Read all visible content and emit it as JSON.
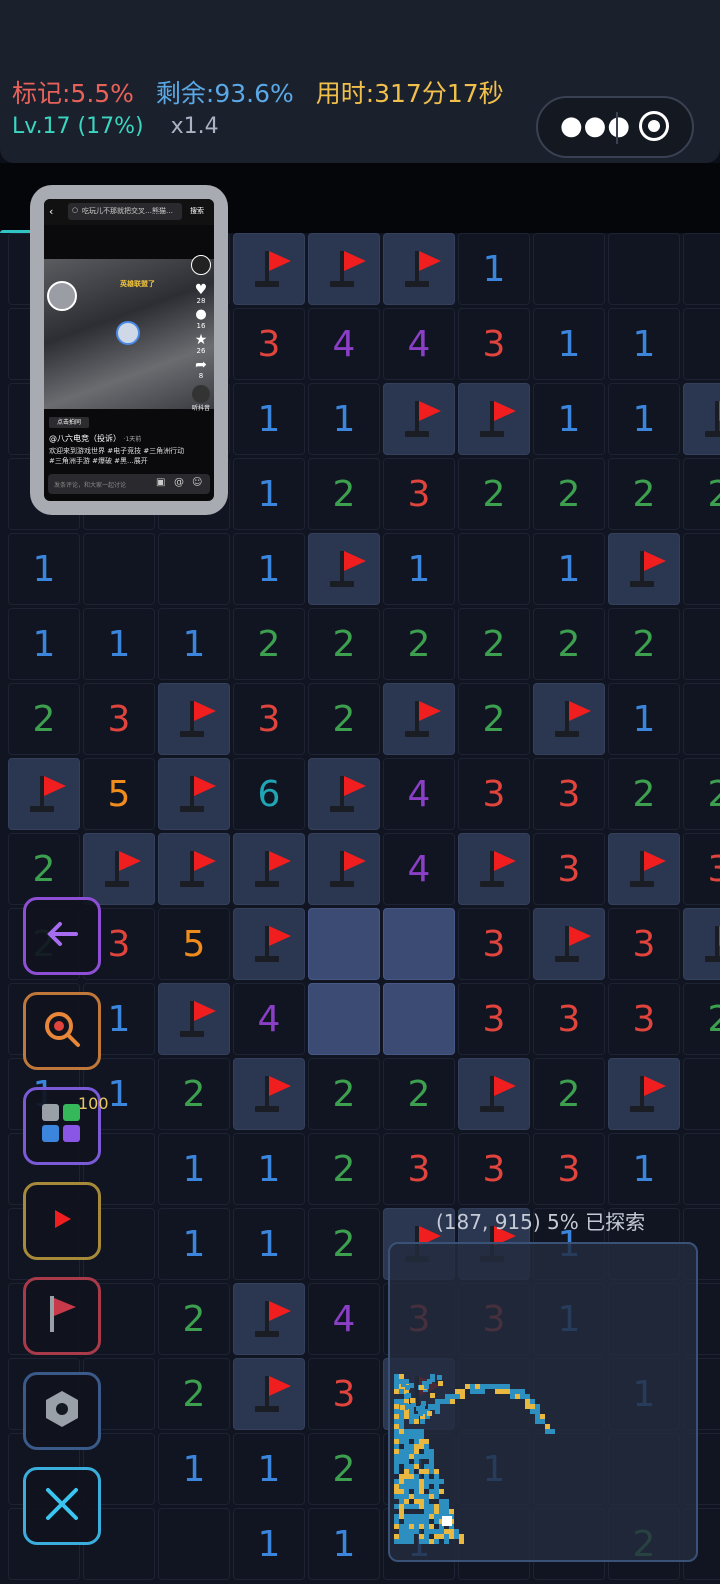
{
  "header": {
    "marked": "标记:5.5%",
    "remaining": "剩余:93.6%",
    "time": "用时:317分17秒",
    "level": "Lv.17 (17%)",
    "speed": "x1.4",
    "colors": {
      "marked": "#e8625a",
      "remaining": "#5aa9e6",
      "time": "#f0c04a",
      "level": "#3ad6c0"
    }
  },
  "capsule": {
    "menu_icon": "more-dots-icon",
    "close_icon": "target-circle-icon"
  },
  "board": {
    "rows": [
      [
        "",
        "",
        "",
        "F",
        "F",
        "F",
        "1",
        "",
        "",
        ""
      ],
      [
        "",
        "",
        "",
        "3",
        "4",
        "4",
        "3",
        "1",
        "1",
        ""
      ],
      [
        "",
        "",
        "",
        "1",
        "1",
        "F",
        "F",
        "1",
        "1",
        "F"
      ],
      [
        "",
        "",
        "",
        "1",
        "2",
        "3",
        "2",
        "2",
        "2",
        "2"
      ],
      [
        "1",
        "",
        "",
        "1",
        "F",
        "1",
        "",
        "1",
        "F",
        ""
      ],
      [
        "1",
        "1",
        "1",
        "2",
        "2",
        "2",
        "2",
        "2",
        "2",
        ""
      ],
      [
        "2",
        "3",
        "F",
        "3",
        "2",
        "F",
        "2",
        "F",
        "1",
        ""
      ],
      [
        "F",
        "5",
        "F",
        "6",
        "F",
        "4",
        "3",
        "3",
        "2",
        "2"
      ],
      [
        "2",
        "F",
        "F",
        "F",
        "F",
        "4",
        "F",
        "3",
        "F",
        "3"
      ],
      [
        "2",
        "3",
        "5",
        "F",
        "S",
        "S",
        "3",
        "F",
        "3",
        "F"
      ],
      [
        "",
        "1",
        "F",
        "4",
        "S",
        "S",
        "3",
        "3",
        "3",
        "2"
      ],
      [
        "1",
        "1",
        "2",
        "F",
        "2",
        "2",
        "F",
        "2",
        "F",
        ""
      ],
      [
        "",
        "",
        "1",
        "1",
        "2",
        "3",
        "3",
        "3",
        "1",
        ""
      ],
      [
        "",
        "",
        "1",
        "1",
        "2",
        "F",
        "F",
        "1",
        "",
        ""
      ],
      [
        "",
        "",
        "2",
        "F",
        "4",
        "3",
        "3",
        "1",
        "",
        ""
      ],
      [
        "",
        "",
        "2",
        "F",
        "3",
        "F",
        "",
        "",
        "1",
        ""
      ],
      [
        "",
        "",
        "1",
        "1",
        "2",
        "1",
        "1",
        "",
        "",
        ""
      ],
      [
        "",
        "",
        "",
        "1",
        "1",
        "1",
        "",
        "",
        "2",
        ""
      ]
    ]
  },
  "tools": [
    {
      "name": "back-tool-button",
      "icon": "back-arrow-icon",
      "color": "#8e4fd6"
    },
    {
      "name": "zoom-tool-button",
      "icon": "magnifier-icon",
      "color": "#c0783a"
    },
    {
      "name": "apps-tool-button",
      "icon": "apps-grid-icon",
      "color": "#7a5ad6",
      "badge": "100"
    },
    {
      "name": "record-tool-button",
      "icon": "play-icon",
      "color": "#a68a3a"
    },
    {
      "name": "flag-tool-button",
      "icon": "flag-icon",
      "color": "#a83a4a"
    },
    {
      "name": "settings-tool-button",
      "icon": "gear-icon",
      "color": "#3a5a8a"
    },
    {
      "name": "close-tool-button",
      "icon": "close-icon",
      "color": "#3aaedc"
    }
  ],
  "phone": {
    "search_text": "吃玩儿不那就把交叉…熊猫…",
    "search_button": "搜索",
    "title_tag": "英雄联盟了",
    "likes": "28",
    "comments": "16",
    "stars": "26",
    "shares": "8",
    "listen": "听抖音",
    "author": "@八六电竞（投诉）",
    "days": "·1天前",
    "desc": "欢迎来到游戏世界 #电子竞技 #三角洲行动 #三角洲手游 #爆破 #黑...展开",
    "follow": "点击拍同",
    "comment_placeholder": "发条评论，和大家一起讨论"
  },
  "minimap": {
    "coords": "(187, 915)",
    "explored": "5% 已探索"
  }
}
